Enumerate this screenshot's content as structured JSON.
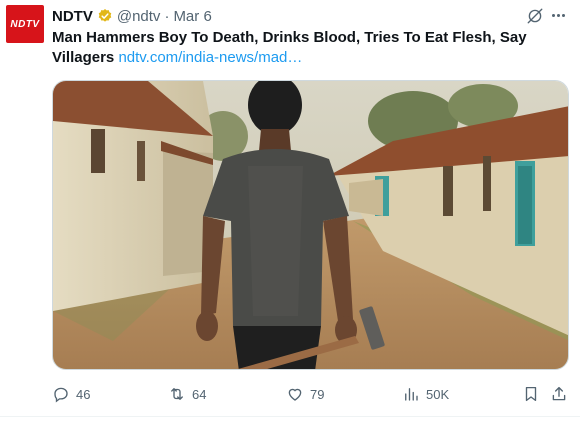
{
  "author": {
    "logo_text": "NDTV",
    "name": "NDTV",
    "handle": "@ndtv",
    "separator": "·",
    "date": "Mar 6"
  },
  "tweet": {
    "text": "Man Hammers Boy To Death, Drinks Blood, Tries To Eat Flesh, Say Villagers",
    "link": "ndtv.com/india-news/mad…"
  },
  "media": {
    "icon": "photo-man-with-hammer-village-road"
  },
  "actions": {
    "replies": "46",
    "reposts": "64",
    "likes": "79",
    "views": "50K"
  },
  "colors": {
    "brand": "#d7141a",
    "link": "#1d9bf0",
    "muted": "#536471",
    "verified_gold": "#e2b719"
  }
}
